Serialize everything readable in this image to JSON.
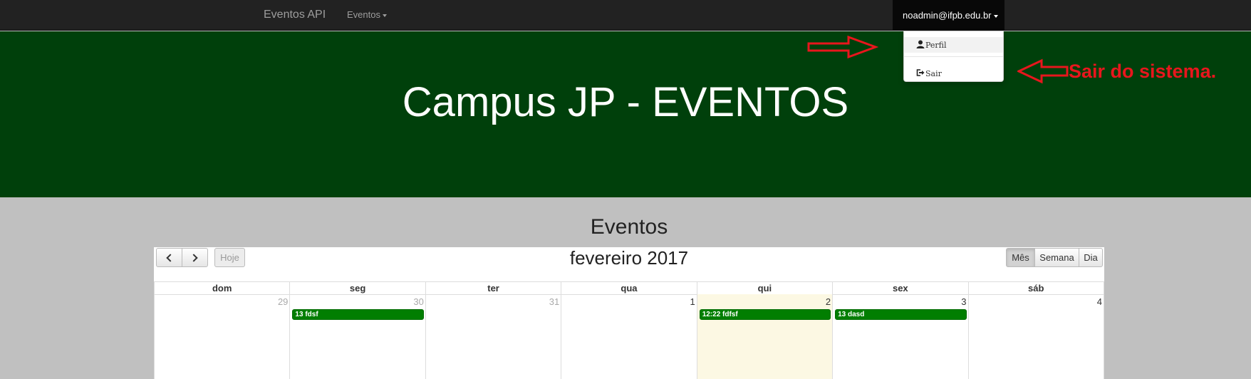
{
  "navbar": {
    "brand": "Eventos API",
    "menu_eventos": "Eventos",
    "user": "noadmin@ifpb.edu.br"
  },
  "user_dropdown": {
    "items": [
      {
        "label": "Perfil",
        "icon": "user-icon"
      },
      {
        "label": "Sair",
        "icon": "logout-icon"
      }
    ]
  },
  "annotation": {
    "text": "Sair do sistema.",
    "color": "#e8161d"
  },
  "hero": {
    "title": "Campus JP - EVENTOS",
    "background": "#00400b"
  },
  "section": {
    "title": "Eventos"
  },
  "calendar": {
    "title": "fevereiro 2017",
    "today_button": "Hoje",
    "views": [
      "Mês",
      "Semana",
      "Dia"
    ],
    "active_view": "Mês",
    "day_names": [
      "dom",
      "seg",
      "ter",
      "qua",
      "qui",
      "sex",
      "sáb"
    ],
    "days": [
      {
        "num": "29",
        "other_month": true,
        "today": false,
        "event": ""
      },
      {
        "num": "30",
        "other_month": true,
        "today": false,
        "event": "13 fdsf"
      },
      {
        "num": "31",
        "other_month": true,
        "today": false,
        "event": ""
      },
      {
        "num": "1",
        "other_month": false,
        "today": false,
        "event": ""
      },
      {
        "num": "2",
        "other_month": false,
        "today": true,
        "event": "12:22 fdfsf"
      },
      {
        "num": "3",
        "other_month": false,
        "today": false,
        "event": "13 dasd"
      },
      {
        "num": "4",
        "other_month": false,
        "today": false,
        "event": ""
      }
    ],
    "event_color": "#017e01",
    "today_color": "#fcf8e3"
  }
}
